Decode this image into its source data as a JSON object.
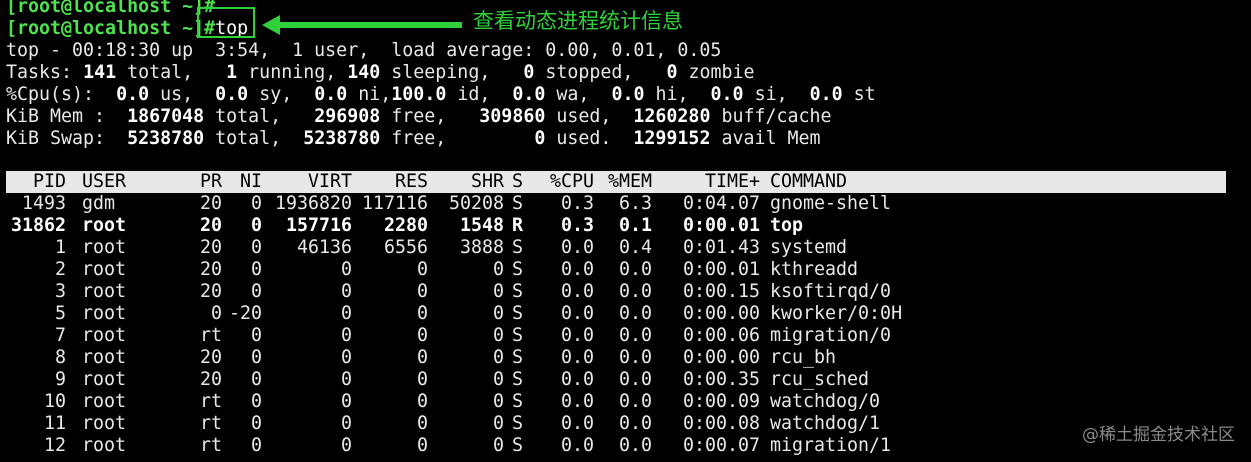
{
  "prompt_lines": [
    {
      "prompt": "[root@localhost ~]#",
      "command": ""
    },
    {
      "prompt": "[root@localhost ~]#",
      "command": "top"
    }
  ],
  "annotation": {
    "text": "查看动态进程统计信息",
    "color": "#2fd13a"
  },
  "summary": {
    "uptime_line": "top - 00:18:30 up  3:54,  1 user,  load average: 0.00, 0.01, 0.05",
    "tasks": {
      "label": "Tasks:",
      "total": "141",
      "running": "1",
      "sleeping": "140",
      "stopped": "0",
      "zombie": "0"
    },
    "cpu": {
      "label": "%Cpu(s):",
      "us": "0.0",
      "sy": "0.0",
      "ni": "0.0",
      "id": "100.0",
      "wa": "0.0",
      "hi": "0.0",
      "si": "0.0",
      "st": "0.0"
    },
    "mem": {
      "label": "KiB Mem :",
      "total": "1867048",
      "free": "296908",
      "used": "309860",
      "buff_cache": "1260280"
    },
    "swap": {
      "label": "KiB Swap:",
      "total": "5238780",
      "free": "5238780",
      "used": "0",
      "avail": "1299152"
    }
  },
  "table": {
    "columns": [
      "PID",
      "USER",
      "PR",
      "NI",
      "VIRT",
      "RES",
      "SHR",
      "S",
      "%CPU",
      "%MEM",
      "TIME+",
      "COMMAND"
    ],
    "rows": [
      {
        "pid": "1493",
        "user": "gdm",
        "pr": "20",
        "ni": "0",
        "virt": "1936820",
        "res": "117116",
        "shr": "50208",
        "s": "S",
        "cpu": "0.3",
        "mem": "6.3",
        "time": "0:04.07",
        "command": "gnome-shell",
        "bold": false
      },
      {
        "pid": "31862",
        "user": "root",
        "pr": "20",
        "ni": "0",
        "virt": "157716",
        "res": "2280",
        "shr": "1548",
        "s": "R",
        "cpu": "0.3",
        "mem": "0.1",
        "time": "0:00.01",
        "command": "top",
        "bold": true
      },
      {
        "pid": "1",
        "user": "root",
        "pr": "20",
        "ni": "0",
        "virt": "46136",
        "res": "6556",
        "shr": "3888",
        "s": "S",
        "cpu": "0.0",
        "mem": "0.4",
        "time": "0:01.43",
        "command": "systemd",
        "bold": false
      },
      {
        "pid": "2",
        "user": "root",
        "pr": "20",
        "ni": "0",
        "virt": "0",
        "res": "0",
        "shr": "0",
        "s": "S",
        "cpu": "0.0",
        "mem": "0.0",
        "time": "0:00.01",
        "command": "kthreadd",
        "bold": false
      },
      {
        "pid": "3",
        "user": "root",
        "pr": "20",
        "ni": "0",
        "virt": "0",
        "res": "0",
        "shr": "0",
        "s": "S",
        "cpu": "0.0",
        "mem": "0.0",
        "time": "0:00.15",
        "command": "ksoftirqd/0",
        "bold": false
      },
      {
        "pid": "5",
        "user": "root",
        "pr": "0",
        "ni": "-20",
        "virt": "0",
        "res": "0",
        "shr": "0",
        "s": "S",
        "cpu": "0.0",
        "mem": "0.0",
        "time": "0:00.00",
        "command": "kworker/0:0H",
        "bold": false
      },
      {
        "pid": "7",
        "user": "root",
        "pr": "rt",
        "ni": "0",
        "virt": "0",
        "res": "0",
        "shr": "0",
        "s": "S",
        "cpu": "0.0",
        "mem": "0.0",
        "time": "0:00.06",
        "command": "migration/0",
        "bold": false
      },
      {
        "pid": "8",
        "user": "root",
        "pr": "20",
        "ni": "0",
        "virt": "0",
        "res": "0",
        "shr": "0",
        "s": "S",
        "cpu": "0.0",
        "mem": "0.0",
        "time": "0:00.00",
        "command": "rcu_bh",
        "bold": false
      },
      {
        "pid": "9",
        "user": "root",
        "pr": "20",
        "ni": "0",
        "virt": "0",
        "res": "0",
        "shr": "0",
        "s": "S",
        "cpu": "0.0",
        "mem": "0.0",
        "time": "0:00.35",
        "command": "rcu_sched",
        "bold": false
      },
      {
        "pid": "10",
        "user": "root",
        "pr": "rt",
        "ni": "0",
        "virt": "0",
        "res": "0",
        "shr": "0",
        "s": "S",
        "cpu": "0.0",
        "mem": "0.0",
        "time": "0:00.09",
        "command": "watchdog/0",
        "bold": false
      },
      {
        "pid": "11",
        "user": "root",
        "pr": "rt",
        "ni": "0",
        "virt": "0",
        "res": "0",
        "shr": "0",
        "s": "S",
        "cpu": "0.0",
        "mem": "0.0",
        "time": "0:00.08",
        "command": "watchdog/1",
        "bold": false
      },
      {
        "pid": "12",
        "user": "root",
        "pr": "rt",
        "ni": "0",
        "virt": "0",
        "res": "0",
        "shr": "0",
        "s": "S",
        "cpu": "0.0",
        "mem": "0.0",
        "time": "0:00.07",
        "command": "migration/1",
        "bold": false
      }
    ]
  },
  "watermark": "@稀土掘金技术社区"
}
